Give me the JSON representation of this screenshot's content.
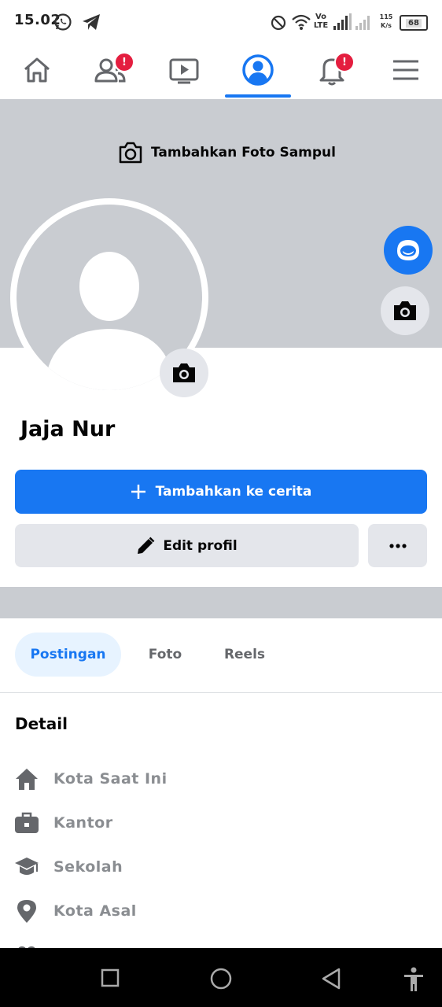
{
  "status_bar": {
    "time": "15.02",
    "network": "Vo LTE",
    "speed_value": "115",
    "speed_unit": "K/s",
    "battery": "68"
  },
  "nav": {
    "friends_badge": "!",
    "notifications_badge": "!"
  },
  "cover": {
    "add_cover_label": "Tambahkan Foto Sampul"
  },
  "profile": {
    "name": "Jaja Nur"
  },
  "buttons": {
    "add_story": "Tambahkan ke cerita",
    "edit_profile": "Edit profil"
  },
  "tabs": [
    {
      "label": "Postingan"
    },
    {
      "label": "Foto"
    },
    {
      "label": "Reels"
    }
  ],
  "details": {
    "title": "Detail",
    "items": [
      {
        "label": "Kota Saat Ini",
        "icon": "home-icon"
      },
      {
        "label": "Kantor",
        "icon": "briefcase-icon"
      },
      {
        "label": "Sekolah",
        "icon": "graduation-cap-icon"
      },
      {
        "label": "Kota Asal",
        "icon": "location-pin-icon"
      }
    ]
  },
  "colors": {
    "accent": "#1877f2",
    "cover_gray": "#c9ccd1",
    "button_gray": "#e4e6eb",
    "badge_red": "#e41e3f",
    "muted_text": "#8a8d91"
  }
}
